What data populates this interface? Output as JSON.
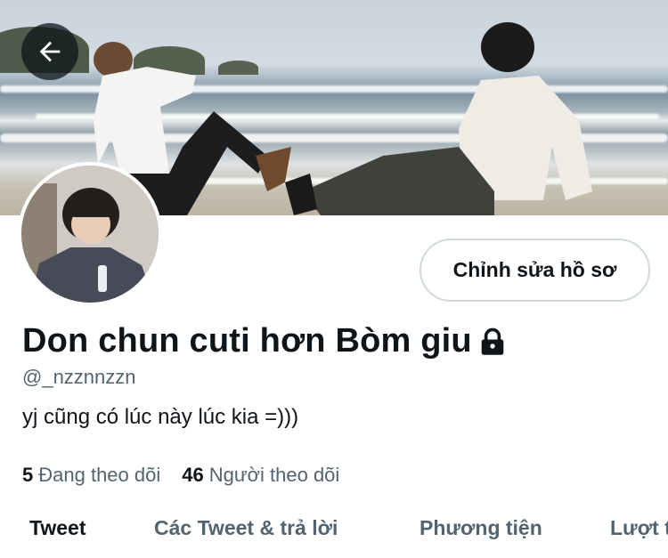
{
  "profile": {
    "display_name": "Don chun cuti hơn Bòm giu",
    "handle": "@_nzznnzzn",
    "bio": "yj cũng có lúc này lúc kia =)))",
    "edit_button_label": "Chỉnh sửa hồ sơ",
    "protected": true
  },
  "stats": {
    "following_count": "5",
    "following_label": "Đang theo dõi",
    "followers_count": "46",
    "followers_label": "Người theo dõi"
  },
  "tabs": [
    {
      "label": "Tweet",
      "active": true
    },
    {
      "label": "Các Tweet & trả lời",
      "active": false
    },
    {
      "label": "Phương tiện",
      "active": false
    },
    {
      "label": "Lượt t",
      "active": false
    }
  ],
  "icons": {
    "back": "arrow-left-icon",
    "lock": "lock-icon"
  },
  "colors": {
    "text_primary": "#0f1419",
    "text_secondary": "#536471",
    "button_border": "#cfd9de"
  }
}
